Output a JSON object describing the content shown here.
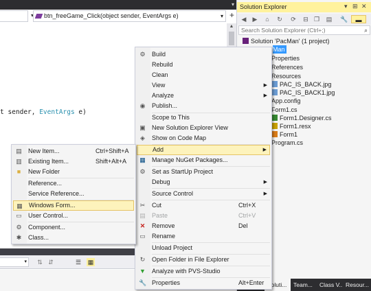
{
  "editor": {
    "method_dropdown": "btn_freeGame_Click(object sender, EventArgs e)",
    "code_visible": {
      "part1": "t sender, ",
      "part2": "EventArgs",
      "part3": " e)"
    },
    "title_chevron": "▾",
    "split_button": "+",
    "scroll_up": "▲",
    "combo_arrow": "▾",
    "icons": [
      "toolbar-icon-1",
      "toolbar-icon-2",
      "toolbar-icon-3",
      "toolbar-icon-4"
    ]
  },
  "solution_explorer": {
    "title": "Solution Explorer",
    "search_placeholder": "Search Solution Explorer (Ctrl+;)",
    "title_controls": [
      "▾",
      "⊞",
      "✕"
    ],
    "toolbar_icons": [
      "back-icon",
      "forward-icon",
      "home-icon",
      "sync-icon",
      "refresh-icon",
      "collapse-icon",
      "copy-icon",
      "show-all-icon",
      "properties-icon",
      "preview-icon"
    ],
    "tree": [
      {
        "label": "Solution 'PacMan' (1 project)"
      },
      {
        "label": "Man",
        "selected": true
      },
      {
        "label": "Properties"
      },
      {
        "label": "References"
      },
      {
        "label": "Resources"
      },
      {
        "label": "PAC_IS_BACK.jpg"
      },
      {
        "label": "PAC_IS_BACK1.jpg"
      },
      {
        "label": "App.config"
      },
      {
        "label": "Form1.cs"
      },
      {
        "label": "Form1.Designer.cs"
      },
      {
        "label": "Form1.resx"
      },
      {
        "label": "Form1"
      },
      {
        "label": "Program.cs"
      }
    ],
    "tabs": [
      "Soluti...",
      "Team...",
      "Class V...",
      "Resour..."
    ]
  },
  "context_menu": {
    "items": [
      {
        "label": "Build",
        "icon": "build-icon"
      },
      {
        "label": "Rebuild"
      },
      {
        "label": "Clean"
      },
      {
        "label": "View",
        "arrow": "▶"
      },
      {
        "label": "Analyze",
        "arrow": "▶"
      },
      {
        "label": "Publish...",
        "icon": "publish-icon"
      },
      {
        "label": "Scope to This"
      },
      {
        "label": "New Solution Explorer View",
        "icon": "new-view-icon"
      },
      {
        "label": "Show on Code Map",
        "icon": "code-map-icon"
      },
      {
        "label": "Add",
        "arrow": "▶",
        "highlighted": true
      },
      {
        "label": "Manage NuGet Packages...",
        "icon": "nuget-icon"
      },
      {
        "label": "Set as StartUp Project",
        "icon": "startup-icon"
      },
      {
        "label": "Debug",
        "arrow": "▶"
      },
      {
        "label": "Source Control",
        "arrow": "▶"
      },
      {
        "label": "Cut",
        "shortcut": "Ctrl+X",
        "icon": "cut-icon"
      },
      {
        "label": "Paste",
        "shortcut": "Ctrl+V",
        "disabled": true,
        "icon": "paste-icon"
      },
      {
        "label": "Remove",
        "shortcut": "Del",
        "icon": "remove-icon"
      },
      {
        "label": "Rename",
        "icon": "rename-icon"
      },
      {
        "label": "Unload Project"
      },
      {
        "label": "Open Folder in File Explorer",
        "icon": "folder-open-icon"
      },
      {
        "label": "Analyze with PVS-Studio",
        "icon": "pvs-studio-icon"
      },
      {
        "label": "Properties",
        "shortcut": "Alt+Enter",
        "icon": "wrench-icon"
      }
    ]
  },
  "add_submenu": {
    "items": [
      {
        "label": "New Item...",
        "shortcut": "Ctrl+Shift+A",
        "icon": "new-item-icon"
      },
      {
        "label": "Existing Item...",
        "shortcut": "Shift+Alt+A",
        "icon": "existing-item-icon"
      },
      {
        "label": "New Folder",
        "icon": "new-folder-icon"
      },
      {
        "label": "Reference..."
      },
      {
        "label": "Service Reference..."
      },
      {
        "label": "Windows Form...",
        "highlighted": true,
        "icon": "windows-form-icon"
      },
      {
        "label": "User Control...",
        "icon": "user-control-icon"
      },
      {
        "label": "Component...",
        "icon": "component-icon"
      },
      {
        "label": "Class...",
        "icon": "class-icon"
      }
    ]
  },
  "colors": {
    "highlight_bg": "#fdf3bc",
    "highlight_border": "#e5c365",
    "selection_blue": "#3399ff",
    "chrome_dark": "#2d2d30",
    "accent_yellow": "#fff29d"
  }
}
